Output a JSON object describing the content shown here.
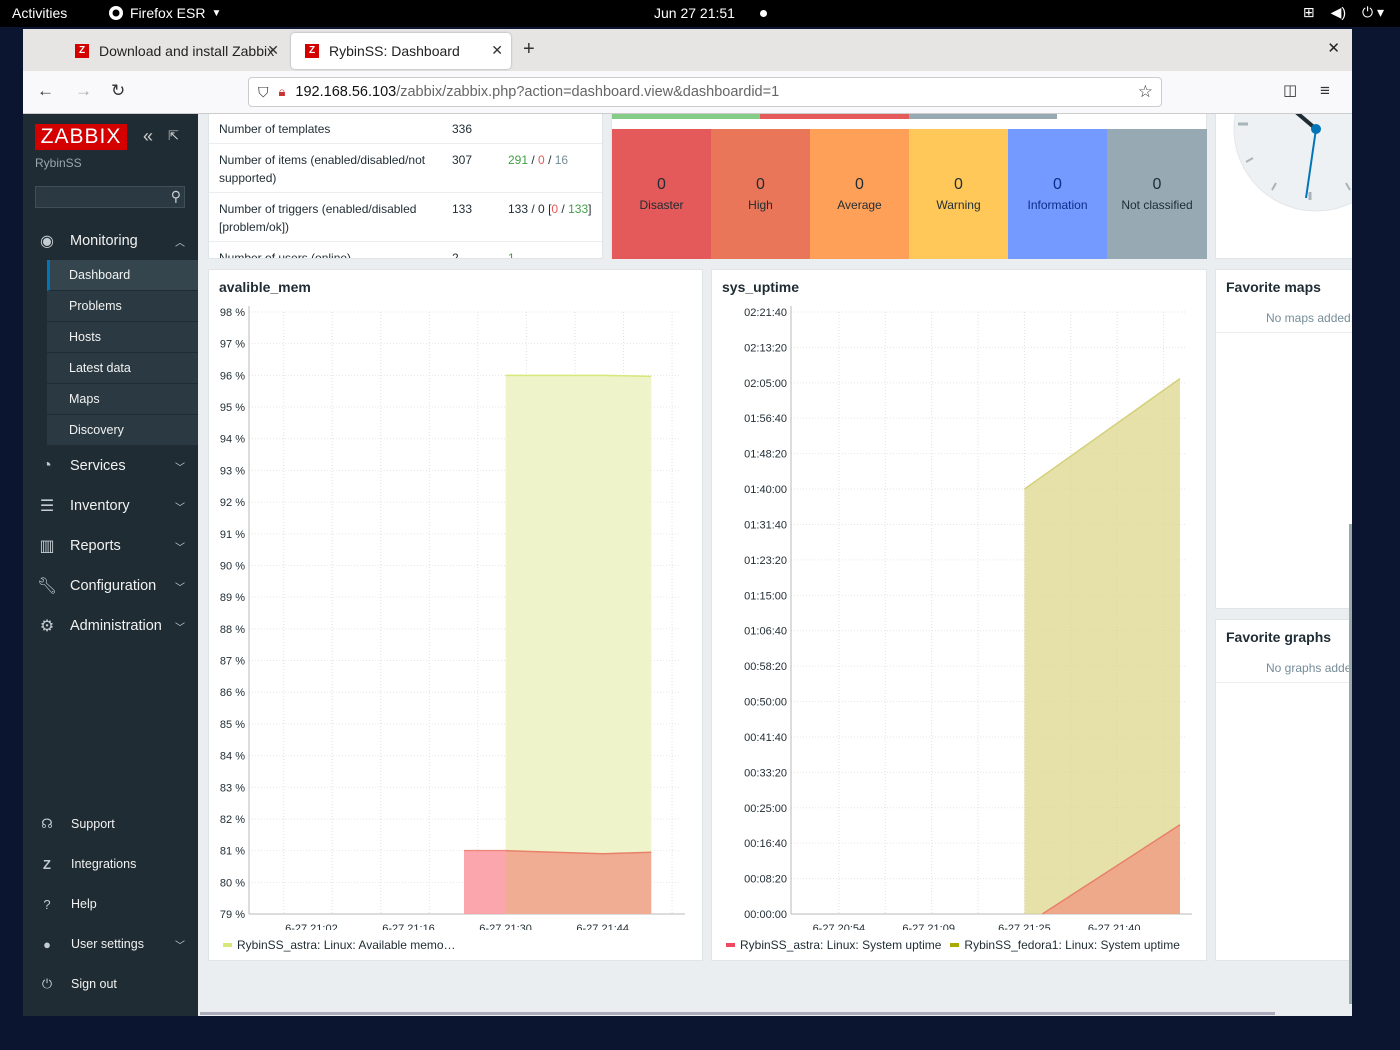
{
  "desktop": {
    "activities": "Activities",
    "app_name": "Firefox ESR",
    "clock": "Jun 27  21:51"
  },
  "browser": {
    "tabs": [
      {
        "title": "Download and install Zabbix",
        "active": false
      },
      {
        "title": "RybinSS: Dashboard",
        "active": true
      }
    ],
    "url_host": "192.168.56.103",
    "url_path": "/zabbix/zabbix.php?action=dashboard.view&dashboardid=1"
  },
  "sidebar": {
    "logo": "ZABBIX",
    "server_name": "RybinSS",
    "search_placeholder": "",
    "monitoring": {
      "label": "Monitoring",
      "items": [
        "Dashboard",
        "Problems",
        "Hosts",
        "Latest data",
        "Maps",
        "Discovery"
      ],
      "selected": "Dashboard"
    },
    "sections": [
      "Services",
      "Inventory",
      "Reports",
      "Configuration",
      "Administration"
    ],
    "footer": [
      "Support",
      "Integrations",
      "Help",
      "User settings",
      "Sign out"
    ]
  },
  "system_info": {
    "rows": [
      {
        "param": "Number of templates",
        "value": "336",
        "details": ""
      },
      {
        "param": "Number of items (enabled/disabled/not supported)",
        "value": "307",
        "details_parts": [
          "291",
          "0",
          "16"
        ]
      },
      {
        "param": "Number of triggers (enabled/disabled [problem/ok])",
        "value": "133",
        "details_parts": [
          "133",
          "0",
          "0",
          "133"
        ]
      },
      {
        "param": "Number of users (online)",
        "value": "2",
        "details": "1"
      }
    ]
  },
  "severity": {
    "colors": {
      "disaster": "#e45959",
      "high": "#e97659",
      "average": "#ffa059",
      "warning": "#ffc859",
      "information": "#7499ff",
      "not_classified": "#97aab3"
    },
    "items": [
      {
        "count": "0",
        "label": "Disaster"
      },
      {
        "count": "0",
        "label": "High"
      },
      {
        "count": "0",
        "label": "Average"
      },
      {
        "count": "0",
        "label": "Warning"
      },
      {
        "count": "0",
        "label": "Information"
      },
      {
        "count": "0",
        "label": "Not classified"
      }
    ]
  },
  "graph_mem": {
    "title": "avalible_mem",
    "legend": "RybinSS_astra: Linux: Available memo…",
    "legend_color": "#d6e87a"
  },
  "graph_uptime": {
    "title": "sys_uptime",
    "legend": [
      {
        "label": "RybinSS_astra: Linux: System uptime",
        "color": "#f04860"
      },
      {
        "label": "RybinSS_fedora1: Linux: System uptime",
        "color": "#a9a900"
      }
    ]
  },
  "fav_maps": {
    "title": "Favorite maps",
    "empty": "No maps added."
  },
  "fav_graphs": {
    "title": "Favorite graphs",
    "empty": "No graphs added."
  },
  "chart_data": [
    {
      "type": "area",
      "title": "avalible_mem",
      "ylabel": "%",
      "ylim": [
        79,
        98
      ],
      "yticks": [
        "98 %",
        "97 %",
        "96 %",
        "95 %",
        "94 %",
        "93 %",
        "92 %",
        "91 %",
        "90 %",
        "89 %",
        "88 %",
        "87 %",
        "86 %",
        "85 %",
        "84 %",
        "83 %",
        "82 %",
        "81 %",
        "80 %",
        "79 %"
      ],
      "xticks": [
        "6-27 21:02",
        "6-27 21:16",
        "6-27 21:30",
        "6-27 21:44"
      ],
      "series": [
        {
          "name": "RybinSS_astra: Linux: Available memo…",
          "x": [
            "6-27 21:30",
            "6-27 21:37",
            "6-27 21:44",
            "6-27 21:51"
          ],
          "values": [
            96.0,
            96.0,
            96.0,
            95.97
          ]
        },
        {
          "name": "",
          "x": [
            "6-27 21:24",
            "6-27 21:30",
            "6-27 21:37",
            "6-27 21:44",
            "6-27 21:51"
          ],
          "values": [
            81.0,
            81.0,
            80.95,
            80.9,
            80.95
          ]
        }
      ],
      "grid": true
    },
    {
      "type": "area",
      "title": "sys_uptime",
      "ylim": [
        "00:00:00",
        "02:21:40"
      ],
      "yticks": [
        "02:21:40",
        "02:13:20",
        "02:05:00",
        "01:56:40",
        "01:48:20",
        "01:40:00",
        "01:31:40",
        "01:23:20",
        "01:15:00",
        "01:06:40",
        "00:58:20",
        "00:50:00",
        "00:41:40",
        "00:33:20",
        "00:25:00",
        "00:16:40",
        "00:08:20",
        "00:00:00"
      ],
      "xticks": [
        "6-27 20:54",
        "6-27 21:09",
        "6-27 21:25",
        "6-27 21:40"
      ],
      "series": [
        {
          "name": "RybinSS_astra: Linux: System uptime",
          "x": [
            "6-27 21:28",
            "6-27 21:51"
          ],
          "values": [
            "00:00:00",
            "00:21:00"
          ]
        },
        {
          "name": "RybinSS_fedora1: Linux: System uptime",
          "x": [
            "6-27 21:25",
            "6-27 21:51"
          ],
          "values": [
            "01:40:00",
            "02:06:00"
          ]
        }
      ],
      "grid": true
    }
  ]
}
